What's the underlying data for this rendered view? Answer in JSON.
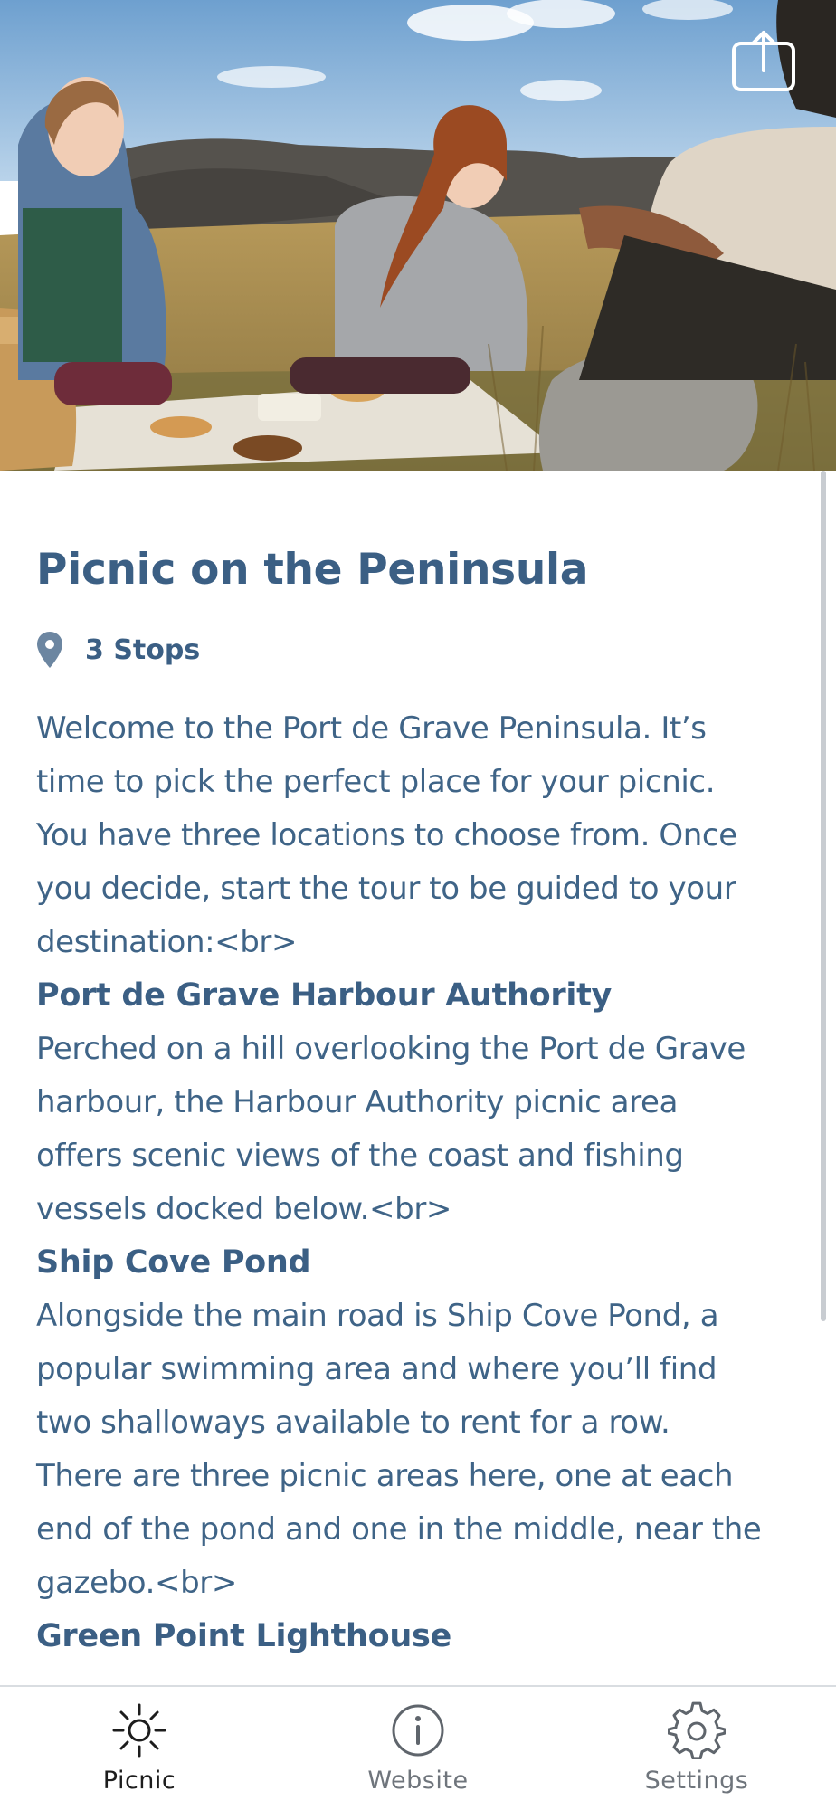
{
  "tour": {
    "title": "Picnic on the Peninsula",
    "stops_label": "3 Stops",
    "intro_lines": [
      "Welcome to the Port de Grave Peninsula. It’s",
      "time to pick the perfect place for your picnic.",
      "You have three locations to choose from. Once",
      "you decide, start the tour to be guided to your",
      "destination:<br>"
    ],
    "stops": [
      {
        "name": "Port de Grave Harbour Authority",
        "lines": [
          "Perched on a hill overlooking the Port de Grave",
          "harbour, the Harbour Authority picnic area",
          "offers scenic views of the coast and fishing",
          "vessels docked below.<br>"
        ]
      },
      {
        "name": "Ship Cove Pond",
        "lines": [
          "Alongside the main road is Ship Cove Pond, a",
          "popular swimming area and where you’ll find",
          "two shalloways available to rent for a row.",
          "There are three picnic areas here, one at each",
          "end of the pond and one in the middle, near the",
          "gazebo.<br>"
        ]
      },
      {
        "name": "Green Point Lighthouse",
        "lines": []
      }
    ]
  },
  "icons": {
    "share": "share-icon",
    "location": "location-pin-icon"
  },
  "nav": {
    "items": [
      {
        "label": "Picnic",
        "icon": "sun-icon",
        "active": true
      },
      {
        "label": "Website",
        "icon": "info-icon",
        "active": false
      },
      {
        "label": "Settings",
        "icon": "gear-icon",
        "active": false
      }
    ]
  },
  "colors": {
    "accent": "#3b5f84",
    "body_text": "#3f6487",
    "nav_inactive": "#6f757c",
    "nav_active": "#1d1d1d"
  }
}
